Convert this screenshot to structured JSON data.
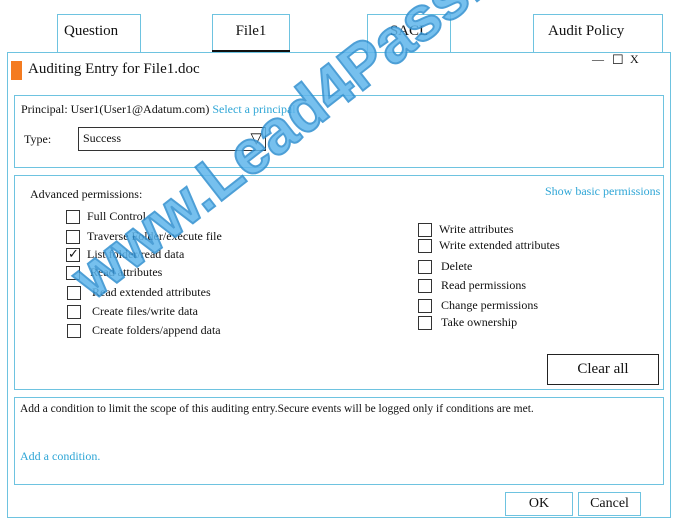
{
  "tabs": [
    {
      "label": "Question"
    },
    {
      "label": "File1",
      "active": true
    },
    {
      "label": "SACL"
    },
    {
      "label": "Audit Policy"
    }
  ],
  "window": {
    "title": "Auditing Entry for File1.doc",
    "accent": "#f47b20",
    "controls": {
      "minimize": "—",
      "maximize": "☐",
      "close": "X"
    }
  },
  "principal": {
    "label": "Principal: User1(User1@Adatum.com)",
    "link": "Select a principal",
    "type_label": "Type:",
    "type_value": "Success"
  },
  "permissions": {
    "heading": "Advanced permissions:",
    "toggle_link": "Show basic permissions",
    "left": [
      {
        "label": "Full Control",
        "checked": false
      },
      {
        "label": "Traverse Folder/execute file",
        "checked": false
      },
      {
        "label": "List folder/read data",
        "checked": true
      },
      {
        "label": "Read attributes",
        "checked": false
      },
      {
        "label": "Read extended attributes",
        "checked": false
      },
      {
        "label": "Create files/write data",
        "checked": false
      },
      {
        "label": "Create folders/append data",
        "checked": false
      }
    ],
    "right": [
      {
        "label": "Write attributes",
        "checked": false
      },
      {
        "label": "Write extended attributes",
        "checked": false
      },
      {
        "label": "Delete",
        "checked": false
      },
      {
        "label": "Read permissions",
        "checked": false
      },
      {
        "label": "Change permissions",
        "checked": false
      },
      {
        "label": "Take ownership",
        "checked": false
      }
    ],
    "clear_all": "Clear all"
  },
  "condition": {
    "text": "Add a condition to limit the scope of this auditing entry.Secure events will be logged only if conditions are met.",
    "link": "Add a condition."
  },
  "buttons": {
    "ok": "OK",
    "cancel": "Cancel"
  },
  "watermark": "www.Lead4Pass.com",
  "colors": {
    "border": "#6ec3e0",
    "link": "#2fa6d6"
  }
}
